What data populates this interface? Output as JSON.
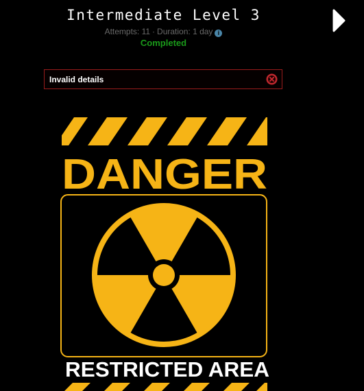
{
  "header": {
    "title": "Intermediate Level 3",
    "attempts": "Attempts: 11",
    "separator": "·",
    "duration": "Duration: 1 day",
    "status": "Completed"
  },
  "alert": {
    "message": "Invalid details"
  },
  "sign": {
    "heading": "DANGER",
    "footer": "RESTRICTED AREA"
  },
  "colors": {
    "background": "#000000",
    "sign_yellow": "#f6b416",
    "status_green": "#1a9a1a",
    "alert_border": "#9a1c1c",
    "alert_icon": "#c0282e",
    "info_icon": "#4a86a8"
  },
  "icons": {
    "next": "chevron-right-icon",
    "error": "close-circle-icon",
    "info": "info-icon",
    "radiation": "radiation-icon"
  }
}
